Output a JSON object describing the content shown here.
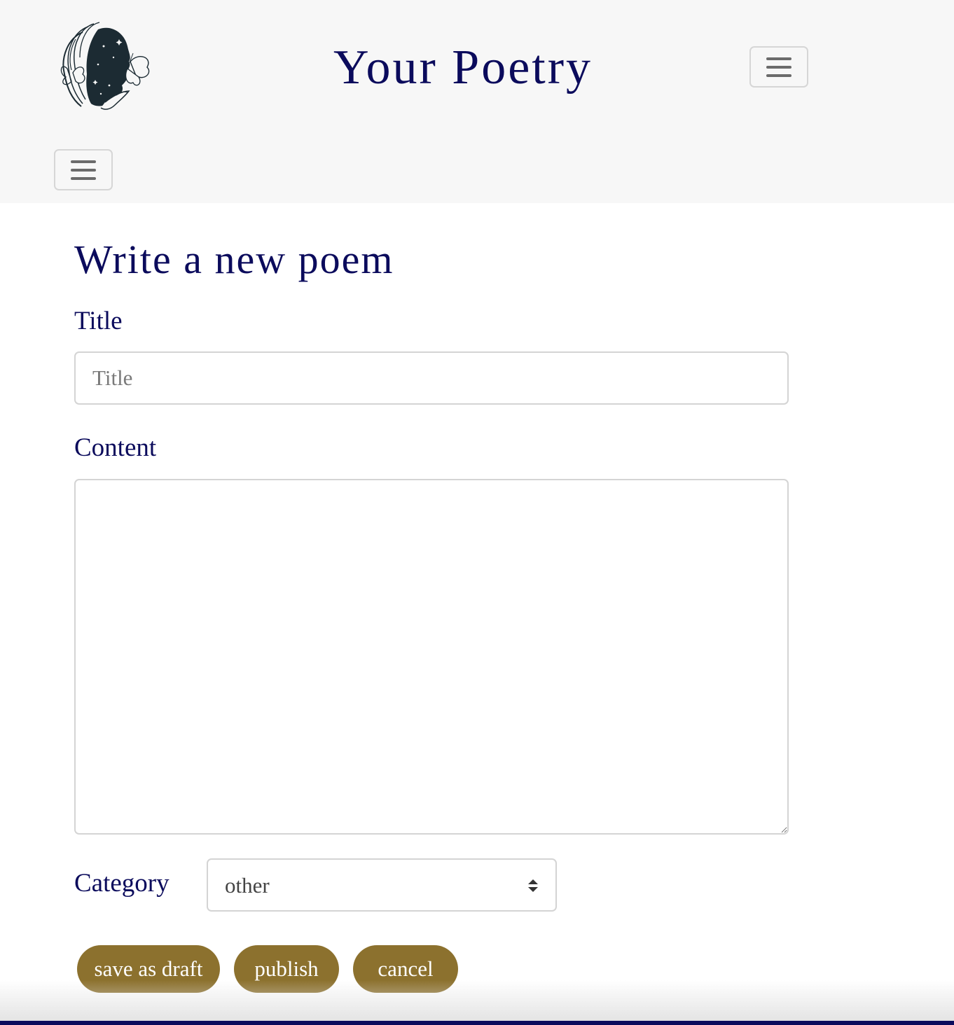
{
  "header": {
    "site_title": "Your Poetry",
    "logo_icon": "poet-face-butterfly-logo",
    "menu_toggle_icon": "hamburger-menu-icon",
    "nav_toggle_icon": "hamburger-menu-icon"
  },
  "form": {
    "heading": "Write a new poem",
    "title_label": "Title",
    "title_placeholder": "Title",
    "title_value": "",
    "content_label": "Content",
    "content_value": "",
    "category_label": "Category",
    "category_selected": "other"
  },
  "actions": {
    "save_draft_label": "save as draft",
    "publish_label": "publish",
    "cancel_label": "cancel"
  },
  "colors": {
    "brand_navy": "#0b0b5c",
    "button_gold": "#8c712e",
    "header_bg": "#f7f7f7"
  }
}
